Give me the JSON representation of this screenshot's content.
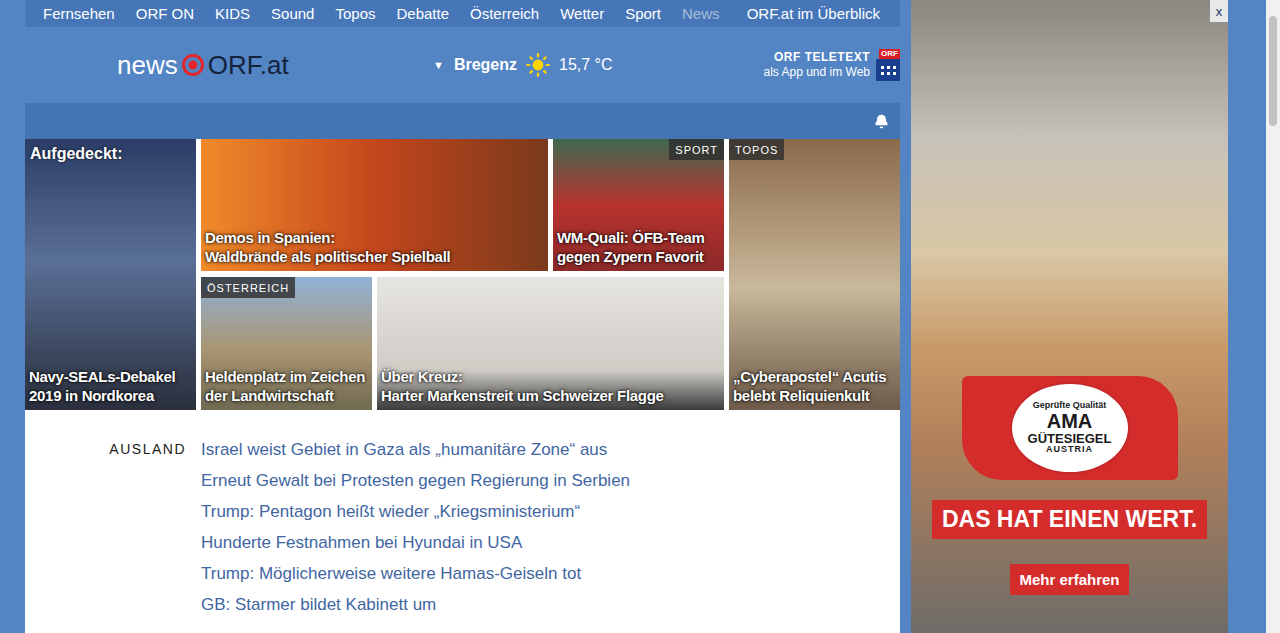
{
  "nav": {
    "items": [
      {
        "label": "Fernsehen",
        "selected": false
      },
      {
        "label": "ORF ON",
        "selected": false
      },
      {
        "label": "KIDS",
        "selected": false
      },
      {
        "label": "Sound",
        "selected": false
      },
      {
        "label": "Topos",
        "selected": false
      },
      {
        "label": "Debatte",
        "selected": false
      },
      {
        "label": "Österreich",
        "selected": false
      },
      {
        "label": "Wetter",
        "selected": false
      },
      {
        "label": "Sport",
        "selected": false
      },
      {
        "label": "News",
        "selected": true
      }
    ],
    "overview": "ORF.at im Überblick"
  },
  "logo": {
    "prefix": "news",
    "brand": "ORF.at"
  },
  "weather": {
    "toggle": "▼",
    "location": "Bregenz",
    "temperature": "15,7 °C"
  },
  "teletext": {
    "title": "ORF TELETEXT",
    "subtitle": "als App und im Web",
    "badge": "ORF"
  },
  "tiles": [
    {
      "kicker": "Aufgedeckt:",
      "tag": "",
      "caption": [
        "Navy-SEALs-Debakel",
        "2019 in Nordkorea"
      ]
    },
    {
      "kicker": "",
      "tag": "",
      "caption": [
        "Demos in Spanien:",
        "Waldbrände als politischer Spielball"
      ]
    },
    {
      "kicker": "",
      "tag": "SPORT",
      "caption": [
        "WM-Quali: ÖFB-Team",
        "gegen Zypern Favorit"
      ]
    },
    {
      "kicker": "",
      "tag": "ÖSTERREICH",
      "caption": [
        "Heldenplatz im Zeichen",
        "der Landwirtschaft"
      ]
    },
    {
      "kicker": "",
      "tag": "",
      "caption": [
        "Über Kreuz:",
        "Harter Markenstreit um Schweizer Flagge"
      ]
    },
    {
      "kicker": "",
      "tag": "TOPOS",
      "caption": [
        "„Cyberapostel“ Acutis",
        "belebt Reliquienkult"
      ]
    }
  ],
  "sections": [
    {
      "label": "AUSLAND",
      "links": [
        "Israel weist Gebiet in Gaza als „humanitäre Zone“ aus",
        "Erneut Gewalt bei Protesten gegen Regierung in Serbien",
        "Trump: Pentagon heißt wieder „Kriegsministerium“",
        "Hunderte Festnahmen bei Hyundai in USA",
        "Trump: Möglicherweise weitere Hamas-Geiseln tot",
        "GB: Starmer bildet Kabinett um"
      ]
    }
  ],
  "ad": {
    "close": "x",
    "seal": {
      "arc": "Geprüfte Qualität",
      "name": "AMA",
      "line": "GÜTESIEGEL",
      "country": "AUSTRIA"
    },
    "slogan": "DAS HAT EINEN WERT.",
    "button": "Mehr erfahren"
  }
}
